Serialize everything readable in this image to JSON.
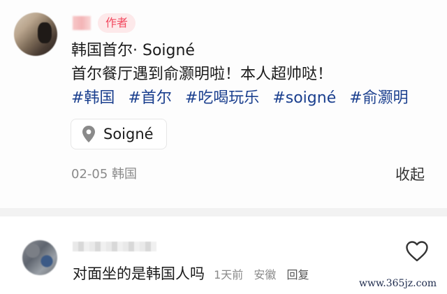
{
  "post": {
    "author_badge": "作者",
    "title": "韩国首尔· Soigné",
    "body": "首尔餐厅遇到俞灏明啦！本人超帅哒！",
    "hashtags": [
      "#韩国",
      "#首尔",
      "#吃喝玩乐",
      "#soigné",
      "#俞灏明"
    ],
    "location": {
      "label": "Soigné",
      "icon": "location-pin-icon"
    },
    "date_location": "02-05 韩国",
    "collapse_label": "收起"
  },
  "comment": {
    "text": "对面坐的是韩国人吗",
    "time": "1天前",
    "region": "安徽",
    "reply_label": "回复",
    "like_icon": "heart-icon"
  },
  "watermark": "www.365jz.com",
  "colors": {
    "hashtag": "#1a3f8e",
    "author_badge_text": "#f2495f",
    "author_badge_bg": "#fde9ea",
    "meta_gray": "#8a8a8a"
  }
}
